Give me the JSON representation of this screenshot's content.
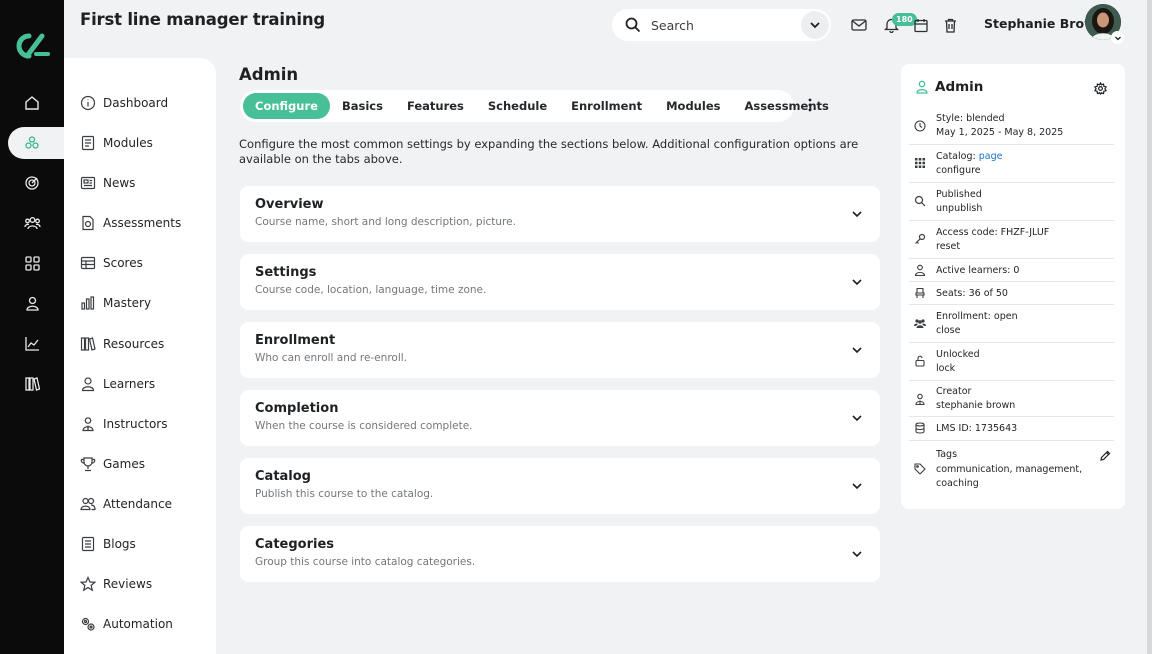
{
  "course_title": "First line manager training",
  "search": {
    "placeholder": "Search"
  },
  "notifications": {
    "count": "180"
  },
  "user": {
    "name": "Stephanie Brown"
  },
  "colors": {
    "accent": "#47bf97",
    "link": "#1a73c9",
    "rail": "#0b0b0c"
  },
  "rail": {
    "items": [
      "home-icon",
      "modules-icon",
      "target-icon",
      "people-icon",
      "apps-icon",
      "user-icon",
      "chart-icon",
      "library-icon"
    ]
  },
  "sidebar": {
    "items": [
      {
        "label": "Dashboard",
        "icon": "info-icon"
      },
      {
        "label": "Modules",
        "icon": "book-icon"
      },
      {
        "label": "News",
        "icon": "news-icon"
      },
      {
        "label": "Assessments",
        "icon": "assessment-icon"
      },
      {
        "label": "Scores",
        "icon": "table-icon"
      },
      {
        "label": "Mastery",
        "icon": "bar-chart-icon"
      },
      {
        "label": "Resources",
        "icon": "library-icon"
      },
      {
        "label": "Learners",
        "icon": "user-icon"
      },
      {
        "label": "Instructors",
        "icon": "instructor-icon"
      },
      {
        "label": "Games",
        "icon": "trophy-icon"
      },
      {
        "label": "Attendance",
        "icon": "group-icon"
      },
      {
        "label": "Blogs",
        "icon": "blog-icon"
      },
      {
        "label": "Reviews",
        "icon": "star-icon"
      },
      {
        "label": "Automation",
        "icon": "gears-icon"
      }
    ]
  },
  "main": {
    "title": "Admin",
    "tabs": [
      "Configure",
      "Basics",
      "Features",
      "Schedule",
      "Enrollment",
      "Modules",
      "Assessments"
    ],
    "intro": "Configure the most common settings by expanding the sections below. Additional configuration options are available on the tabs above.",
    "sections": [
      {
        "title": "Overview",
        "desc": "Course name, short and long description, picture."
      },
      {
        "title": "Settings",
        "desc": "Course code, location, language, time zone."
      },
      {
        "title": "Enrollment",
        "desc": "Who can enroll and re-enroll."
      },
      {
        "title": "Completion",
        "desc": "When the course is considered complete."
      },
      {
        "title": "Catalog",
        "desc": "Publish this course to the catalog."
      },
      {
        "title": "Categories",
        "desc": "Group this course into catalog categories."
      }
    ]
  },
  "panel": {
    "title": "Admin",
    "style": "Style: blended",
    "dates": "May 1, 2025 - May 8, 2025",
    "catalog_label": "Catalog: ",
    "catalog_page": "page",
    "catalog_configure": "configure",
    "published": "Published",
    "unpublish": "unpublish",
    "access_code": "Access code: FHZF-JLUF",
    "reset": "reset",
    "active_learners": "Active learners: 0",
    "seats": "Seats: 36 of 50",
    "enrollment": "Enrollment: open",
    "close": "close",
    "unlocked": "Unlocked",
    "lock": "lock",
    "creator": "Creator",
    "creator_name": "stephanie brown",
    "lms_id": "LMS ID: 1735643",
    "tags_label": "Tags",
    "tags_line1": "communication, management,",
    "tags_line2": "coaching"
  }
}
